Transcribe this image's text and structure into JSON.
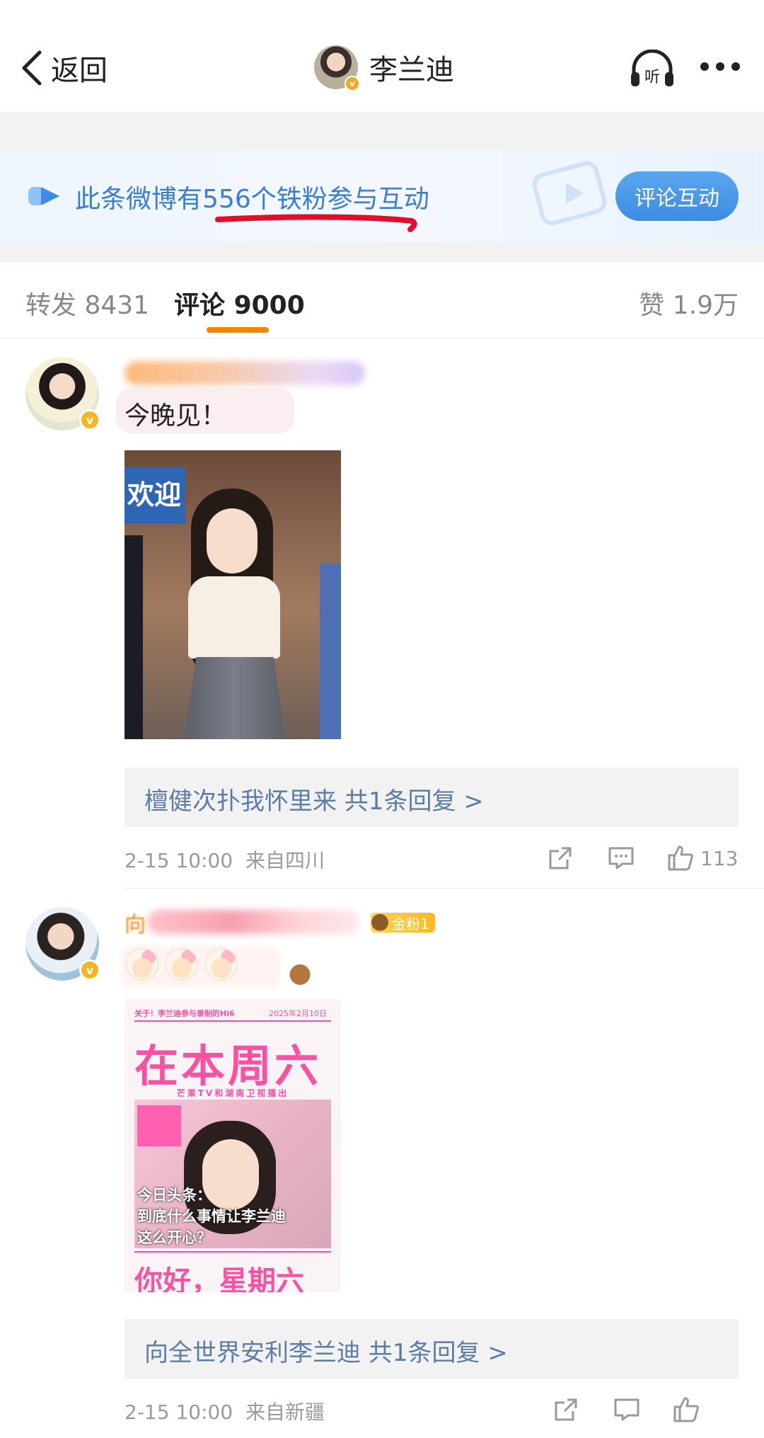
{
  "header": {
    "back_label": "返回",
    "profile_name": "李兰迪",
    "listen_label": "听",
    "verified_badge": "v"
  },
  "banner": {
    "text_prefix": "此条微博有",
    "count": "556",
    "text_suffix": "个铁粉参与互动",
    "button_label": "评论互动",
    "accent_color": "#3a7dd6",
    "annotation_color": "#e0102a"
  },
  "tabs": {
    "repost_label": "转发",
    "repost_count": "8431",
    "comment_label": "评论",
    "comment_count": "9000",
    "like_label": "赞",
    "like_count": "1.9万",
    "active": "评论",
    "indicator_color": "#ff8200"
  },
  "comments": [
    {
      "text": "今晚见！",
      "image_sign": "欢迎",
      "reply_text": "檀健次扑我怀里来  共1条回复 >",
      "time": "2-15 10:00",
      "location": "来自四川",
      "like_count": "113"
    },
    {
      "name_prefix": "向",
      "fan_badge": "金粉1",
      "poster": {
        "top_text": "关于！李兰迪参与录制的Hi6",
        "date": "2025年2月10日",
        "big_text": "在本周六",
        "sub_text": "芒果TV和湖南卫视播出",
        "headline_1": "今日头条：",
        "headline_2": "到底什么事情让李兰迪",
        "headline_3": "这么开心？",
        "bottom_text": "你好，星期六"
      },
      "reply_text": "向全世界安利李兰迪  共1条回复 >",
      "time": "2-15 10:00",
      "location": "来自新疆"
    }
  ],
  "icons": [
    "chevron-left-icon",
    "headphones-icon",
    "more-icon",
    "play-icon",
    "share-icon",
    "comment-icon",
    "like-icon",
    "verified-icon"
  ]
}
